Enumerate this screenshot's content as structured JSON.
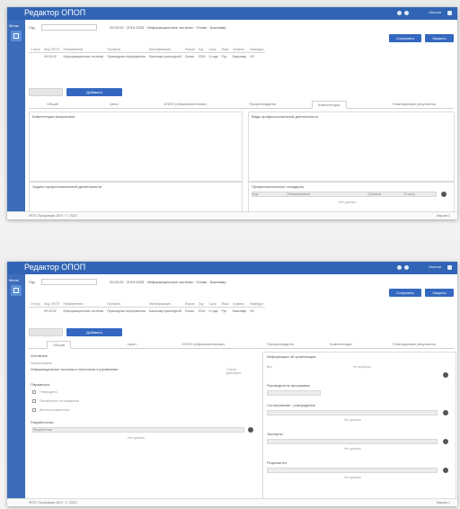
{
  "app": {
    "title": "Редактор ОПОП",
    "user": "Иванов",
    "sidebar_label": "Меню",
    "filter_label": "Год:",
    "filter_text": "09.03.02 · 2019-2023 · Информационные системы · Очная · Бакалавр",
    "save_label": "Сохранить",
    "close_label": "Закрыть",
    "add_label": "Добавить",
    "status_left": "ФГОС Программа 2019 · 1 / 2023",
    "status_right": "Версия 1"
  },
  "table": {
    "headers": [
      "Статус",
      "Код ОПОП",
      "Направление",
      "Профиль",
      "Квалификация",
      "Форма",
      "Год",
      "Срок",
      "Язык",
      "Уровень",
      "Кафедра"
    ],
    "row": [
      "",
      "09.03.02",
      "Информационные системы",
      "Прикладная информатика",
      "Бакалавр прикладной",
      "Очная",
      "2019",
      "4 года",
      "Рус.",
      "Бакалавр",
      "ИС"
    ]
  },
  "window1": {
    "tabs": [
      "Общие",
      "Цели",
      "ОПОП (образовательная)",
      "Профстандарты",
      "Компетенции",
      "Планируемые результаты"
    ],
    "active_tab": 4,
    "panel_left_title": "Компетенции выпускника",
    "panel_right_title": "Виды профессиональной деятельности",
    "panel_bottom_left_title": "Задачи профессиональной деятельности",
    "panel_bottom_right_title": "Профессиональные стандарты",
    "table_headers": [
      "Код",
      "Наименование",
      "Уровень",
      "Статус"
    ],
    "empty_note": "Нет данных"
  },
  "window2": {
    "tabs": [
      "Общие",
      "Цели",
      "ОПОП (образовательная)",
      "Профстандарты",
      "Компетенции",
      "Планируемые результаты"
    ],
    "active_tab": 0,
    "section_main": "Основные",
    "field_name_label": "Наименование",
    "field_name_value": "Информационные системы и технологии в управлении",
    "field_name_side": "Статус: действует",
    "section_params": "Параметры",
    "checkboxes": [
      "Утверждено",
      "Рассмотрено на заседании",
      "Внесены изменения"
    ],
    "section_dev": "Разработчики",
    "dev_bar_text": "Разработчик",
    "dev_note": "Нет данных",
    "right_section1": "Информация об организации",
    "right_field1_label": "Вуз",
    "right_field1_value": "Не выбрано",
    "right_section2": "Руководитель программы",
    "right_section3": "Согласование / утверждение",
    "right_section4": "Эксперты",
    "right_section5": "Рецензенты",
    "right_note": "Нет данных"
  },
  "colors": {
    "titlebar": "#3164b4",
    "sidebar": "#3d6cbb",
    "primary_button": "#3468c0"
  }
}
